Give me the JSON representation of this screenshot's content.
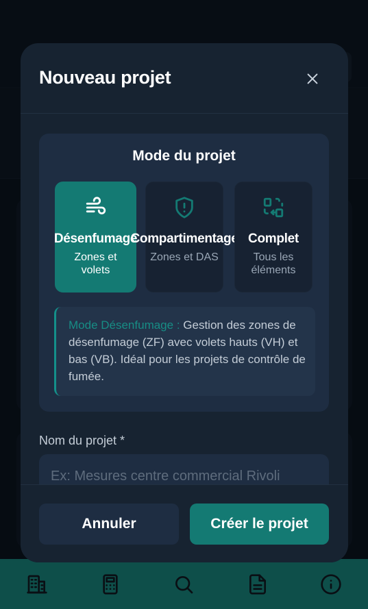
{
  "modal": {
    "title": "Nouveau projet",
    "mode_section_title": "Mode du projet",
    "modes": [
      {
        "name": "Désenfumage",
        "description": "Zones et volets",
        "icon": "wind-icon",
        "active": true
      },
      {
        "name": "Compartimentage",
        "description": "Zones et DAS",
        "icon": "shield-alert-icon",
        "active": false
      },
      {
        "name": "Complet",
        "description": "Tous les éléments",
        "icon": "components-icon",
        "active": false
      }
    ],
    "info": {
      "label": "Mode Désenfumage :",
      "text": " Gestion des zones de désenfumage (ZF) avec volets hauts (VH) et bas (VB). Idéal pour les projets de contrôle de fumée."
    },
    "project_name_label": "Nom du projet *",
    "project_name_placeholder": "Ex: Mesures centre commercial Rivoli",
    "project_name_value": "",
    "cancel_label": "Annuler",
    "create_label": "Créer le projet"
  },
  "bottom_nav": {
    "items": [
      {
        "icon": "building-icon"
      },
      {
        "icon": "calculator-icon"
      },
      {
        "icon": "search-icon"
      },
      {
        "icon": "document-icon"
      },
      {
        "icon": "info-icon"
      }
    ]
  },
  "colors": {
    "accent": "#147a73",
    "modal_bg": "#172331",
    "panel_bg": "#1e2d42",
    "nav_bg": "#0e4f4a"
  }
}
